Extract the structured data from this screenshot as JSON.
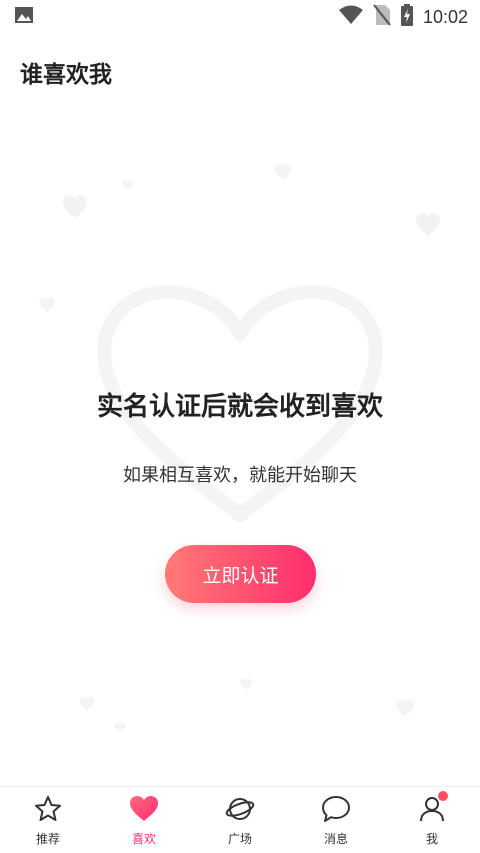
{
  "status_bar": {
    "time": "10:02",
    "left_icon": "image-notification-icon",
    "right_icons": [
      "wifi-icon",
      "no-sim-icon",
      "battery-charging-icon"
    ]
  },
  "page": {
    "title": "谁喜欢我"
  },
  "empty_state": {
    "headline": "实名认证后就会收到喜欢",
    "subline": "如果相互喜欢，就能开始聊天",
    "cta_label": "立即认证"
  },
  "tab_bar": {
    "items": [
      {
        "label": "推荐",
        "icon": "star-icon",
        "active": false
      },
      {
        "label": "喜欢",
        "icon": "heart-icon",
        "active": true
      },
      {
        "label": "广场",
        "icon": "planet-icon",
        "active": false
      },
      {
        "label": "消息",
        "icon": "chat-bubble-icon",
        "active": false
      },
      {
        "label": "我",
        "icon": "person-icon",
        "active": false,
        "badge": true
      }
    ]
  },
  "colors": {
    "accent": "#ff2d6e",
    "cta_gradient_start": "#ff7a74",
    "cta_gradient_end": "#ff2d6e",
    "badge": "#ff4d5e"
  }
}
